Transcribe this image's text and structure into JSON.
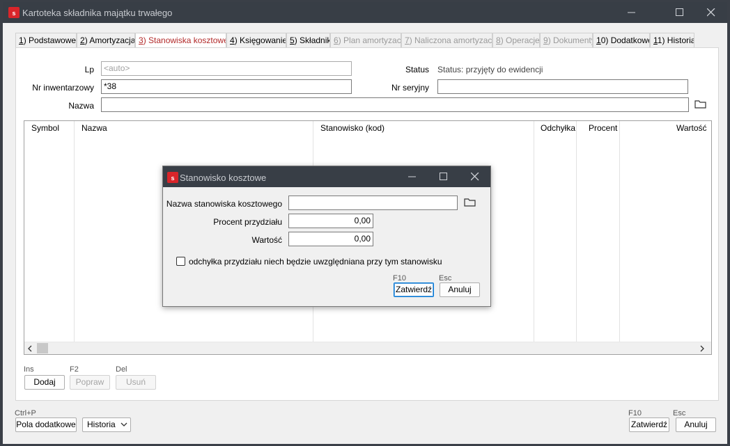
{
  "window": {
    "title": "Kartoteka składnika majątku trwałego",
    "logo_letter": "s"
  },
  "tabs": [
    {
      "key": "1",
      "label": ") Podstawowe",
      "state": "normal"
    },
    {
      "key": "2",
      "label": ") Amortyzacja",
      "state": "normal"
    },
    {
      "key": "3",
      "label": ") Stanowiska kosztowe",
      "state": "active"
    },
    {
      "key": "4",
      "label": ") Księgowanie",
      "state": "normal"
    },
    {
      "key": "5",
      "label": ") Składniki",
      "state": "normal"
    },
    {
      "key": "6",
      "label": ") Plan amortyzacji",
      "state": "disabled"
    },
    {
      "key": "7",
      "label": ") Naliczona amortyzacja",
      "state": "disabled"
    },
    {
      "key": "8",
      "label": ") Operacje",
      "state": "disabled"
    },
    {
      "key": "9",
      "label": ") Dokumenty",
      "state": "disabled"
    },
    {
      "key": "1",
      "label": "0) Dodatkowe",
      "state": "normal"
    },
    {
      "key": "1",
      "label": "1) Historia",
      "state": "normal"
    }
  ],
  "form": {
    "lp_label": "Lp",
    "lp_placeholder": "<auto>",
    "status_label": "Status",
    "status_value": "Status: przyjęty do ewidencji",
    "nr_inw_label": "Nr inwentarzowy",
    "nr_inw_value": "*38",
    "nr_ser_label": "Nr seryjny",
    "nr_ser_value": "",
    "nazwa_label": "Nazwa",
    "nazwa_value": ""
  },
  "table": {
    "columns": [
      "Symbol",
      "Nazwa",
      "Stanowisko (kod)",
      "Odchyłka",
      "Procent",
      "Wartość"
    ],
    "rows": []
  },
  "list_buttons": {
    "add_hotkey": "Ins",
    "add_label": "Dodaj",
    "edit_hotkey": "F2",
    "edit_label": "Popraw",
    "delete_hotkey": "Del",
    "delete_label": "Usuń"
  },
  "footer": {
    "extra_hotkey": "Ctrl+P",
    "extra_label": "Pola dodatkowe",
    "history_label": "Historia",
    "confirm_hotkey": "F10",
    "confirm_label": "Zatwierdź",
    "cancel_hotkey": "Esc",
    "cancel_label": "Anuluj"
  },
  "dialog": {
    "title": "Stanowisko kosztowe",
    "name_label": "Nazwa stanowiska kosztowego",
    "name_value": "",
    "percent_label": "Procent przydziału",
    "percent_value": "0,00",
    "value_label": "Wartość",
    "value_value": "0,00",
    "checkbox_label": "odchyłka przydziału niech będzie uwzględniana przy tym stanowisku",
    "checkbox_checked": false,
    "confirm_hotkey": "F10",
    "confirm_label": "Zatwierdź",
    "cancel_hotkey": "Esc",
    "cancel_label": "Anuluj"
  },
  "colors": {
    "titlebar": "#383e46",
    "active_tab_text": "#b22a2a",
    "logo": "#d9252a"
  }
}
